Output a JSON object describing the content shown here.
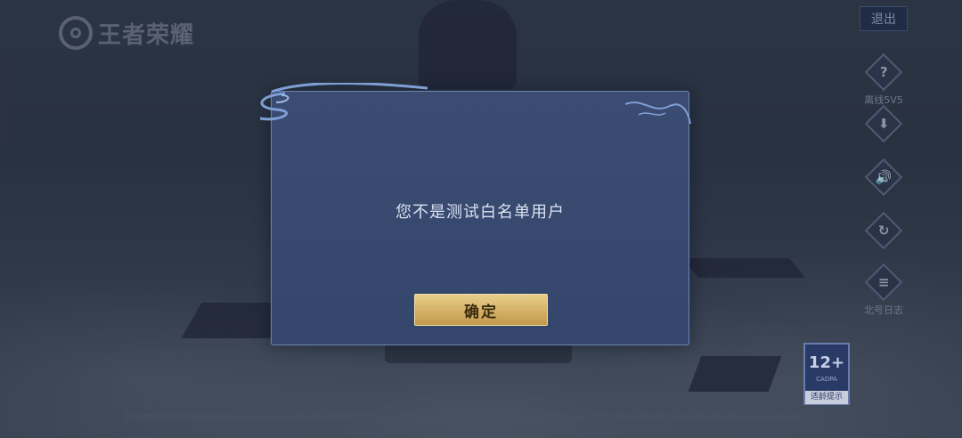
{
  "app": {
    "logo_text": "王者荣耀"
  },
  "header": {
    "exit_label": "退出"
  },
  "right_buttons": [
    {
      "icon": "help-icon",
      "glyph": "?",
      "label": "离线5V5"
    },
    {
      "icon": "download-icon",
      "glyph": "⬇",
      "label": ""
    },
    {
      "icon": "sound-icon",
      "glyph": "🔊",
      "label": ""
    },
    {
      "icon": "repair-icon",
      "glyph": "↻",
      "label": ""
    },
    {
      "icon": "notes-icon",
      "glyph": "≡",
      "label": "北号日志"
    }
  ],
  "age_rating": {
    "number": "12+",
    "org": "CADPA",
    "note": "适龄提示"
  },
  "dialog": {
    "message": "您不是测试白名单用户",
    "confirm_label": "确定"
  },
  "colors": {
    "accent_gold": "#d4b064",
    "dialog_bg": "#3a4b70",
    "dialog_border": "#6e85b4"
  }
}
